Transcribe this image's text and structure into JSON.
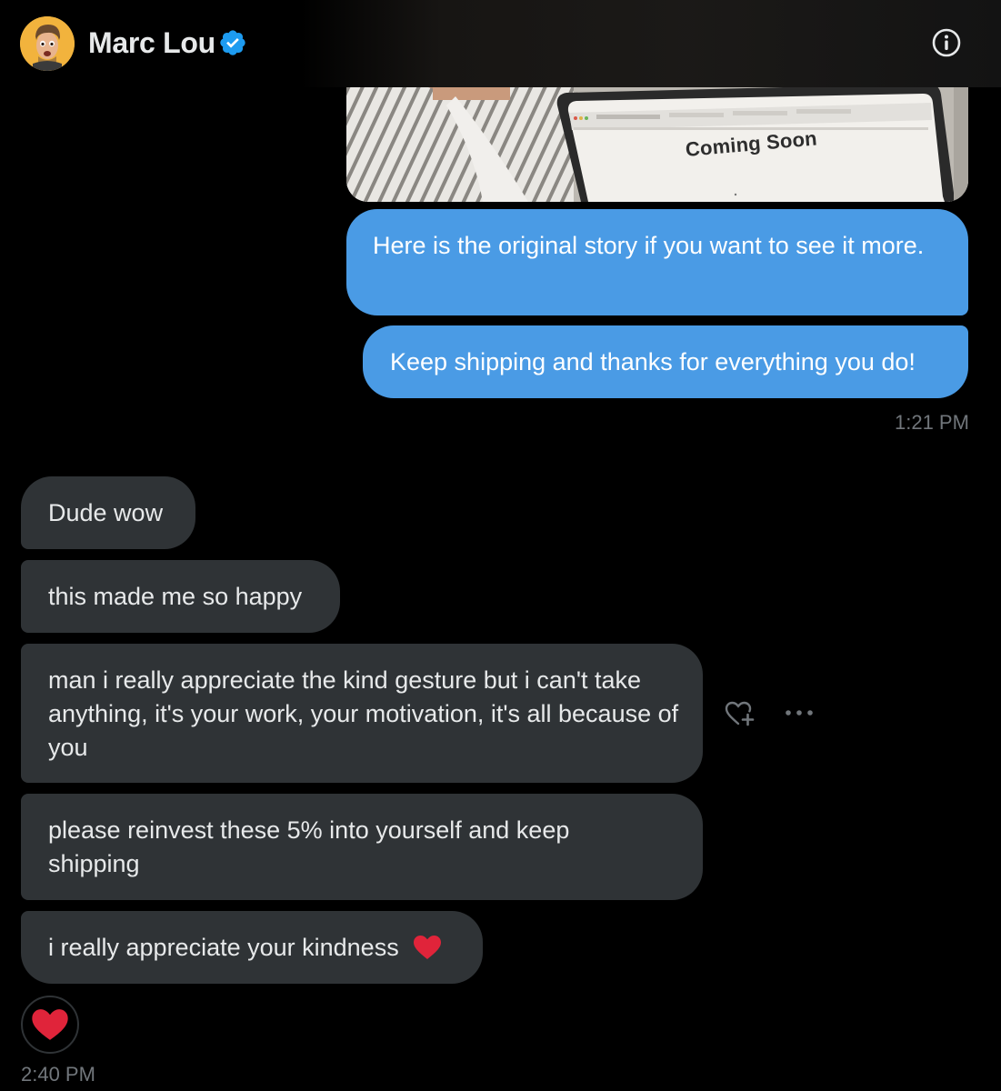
{
  "header": {
    "name": "Marc Lou",
    "verified_icon": "verified-badge-icon",
    "info_icon": "info-icon"
  },
  "story_image": {
    "screen_text": "Coming Soon"
  },
  "messages": {
    "sent": [
      "Here is the original story if you want to see it more.",
      "Keep shipping and thanks for everything you do!"
    ],
    "sent_time": "1:21 PM",
    "received": [
      "Dude wow",
      "this made me so happy",
      "man i really appreciate the kind gesture but i can't take anything, it's your work, your motivation, it's all because of you",
      "please reinvest these 5% into yourself and keep shipping",
      "i really appreciate your kindness"
    ],
    "received_time": "2:40 PM",
    "reaction": "heart-icon"
  },
  "colors": {
    "background": "#000000",
    "sent_bubble": "#4a9be5",
    "received_bubble": "#2f3336",
    "timestamp": "#71767b",
    "heart": "#e0243a",
    "verified": "#1d9bf0"
  }
}
